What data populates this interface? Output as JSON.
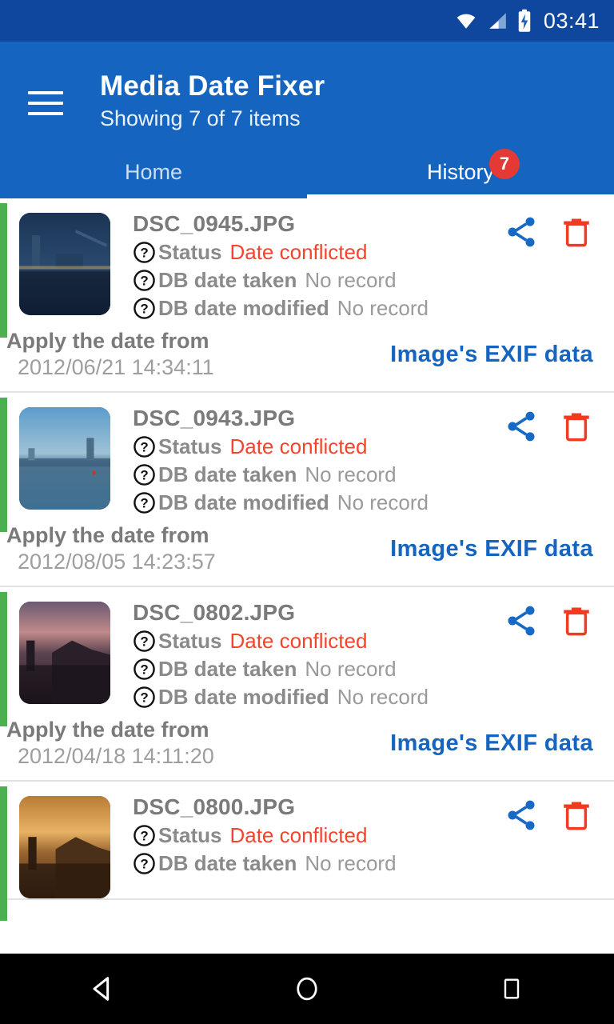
{
  "status_bar": {
    "time": "03:41",
    "icons": [
      "wifi-icon",
      "cellular-signal-icon",
      "battery-charging-icon"
    ]
  },
  "app_bar": {
    "menu_icon": "hamburger-menu-icon",
    "title": "Media Date Fixer",
    "subtitle": "Showing 7 of 7 items",
    "background_color": "#1565C0",
    "tabs": [
      {
        "label": "Home",
        "active": false,
        "badge": ""
      },
      {
        "label": "History",
        "active": true,
        "badge": "7"
      }
    ],
    "badge_color": "#E53935"
  },
  "list": {
    "labels": {
      "status": "Status",
      "db_date_taken": "DB date taken",
      "db_date_modified": "DB date modified",
      "apply_from": "Apply the date from"
    },
    "accent_color": "#4CAF50",
    "conflict_color": "#F4442E",
    "link_color": "#1565C0",
    "items": [
      {
        "filename": "DSC_0945.JPG",
        "status": "Date conflicted",
        "db_date_taken": "No record",
        "db_date_modified": "No record",
        "apply_date": "2012/06/21 14:34:11",
        "apply_source": "Image's EXIF data",
        "share_icon": "share-icon",
        "delete_icon": "delete-icon",
        "thumb_colors": [
          "#0e1d33",
          "#1b3454",
          "#2b4b70",
          "#16283f"
        ]
      },
      {
        "filename": "DSC_0943.JPG",
        "status": "Date conflicted",
        "db_date_taken": "No record",
        "db_date_modified": "No record",
        "apply_date": "2012/08/05 14:23:57",
        "apply_source": "Image's EXIF data",
        "share_icon": "share-icon",
        "delete_icon": "delete-icon",
        "thumb_colors": [
          "#5b9ccb",
          "#7fb4d6",
          "#9fbfcf",
          "#3f6f91"
        ]
      },
      {
        "filename": "DSC_0802.JPG",
        "status": "Date conflicted",
        "db_date_taken": "No record",
        "db_date_modified": "No record",
        "apply_date": "2012/04/18 14:11:20",
        "apply_source": "Image's EXIF data",
        "share_icon": "share-icon",
        "delete_icon": "delete-icon",
        "thumb_colors": [
          "#6b5a72",
          "#c08a8a",
          "#46343f",
          "#22181f"
        ]
      },
      {
        "filename": "DSC_0800.JPG",
        "status": "Date conflicted",
        "db_date_taken": "No record",
        "db_date_modified": "",
        "apply_date": "",
        "apply_source": "",
        "share_icon": "share-icon",
        "delete_icon": "delete-icon",
        "thumb_colors": [
          "#c98a3c",
          "#e0a85a",
          "#8a5a2a",
          "#3a2415"
        ]
      }
    ]
  },
  "nav_bar": {
    "buttons": [
      "back-button",
      "home-button",
      "recents-button"
    ]
  }
}
